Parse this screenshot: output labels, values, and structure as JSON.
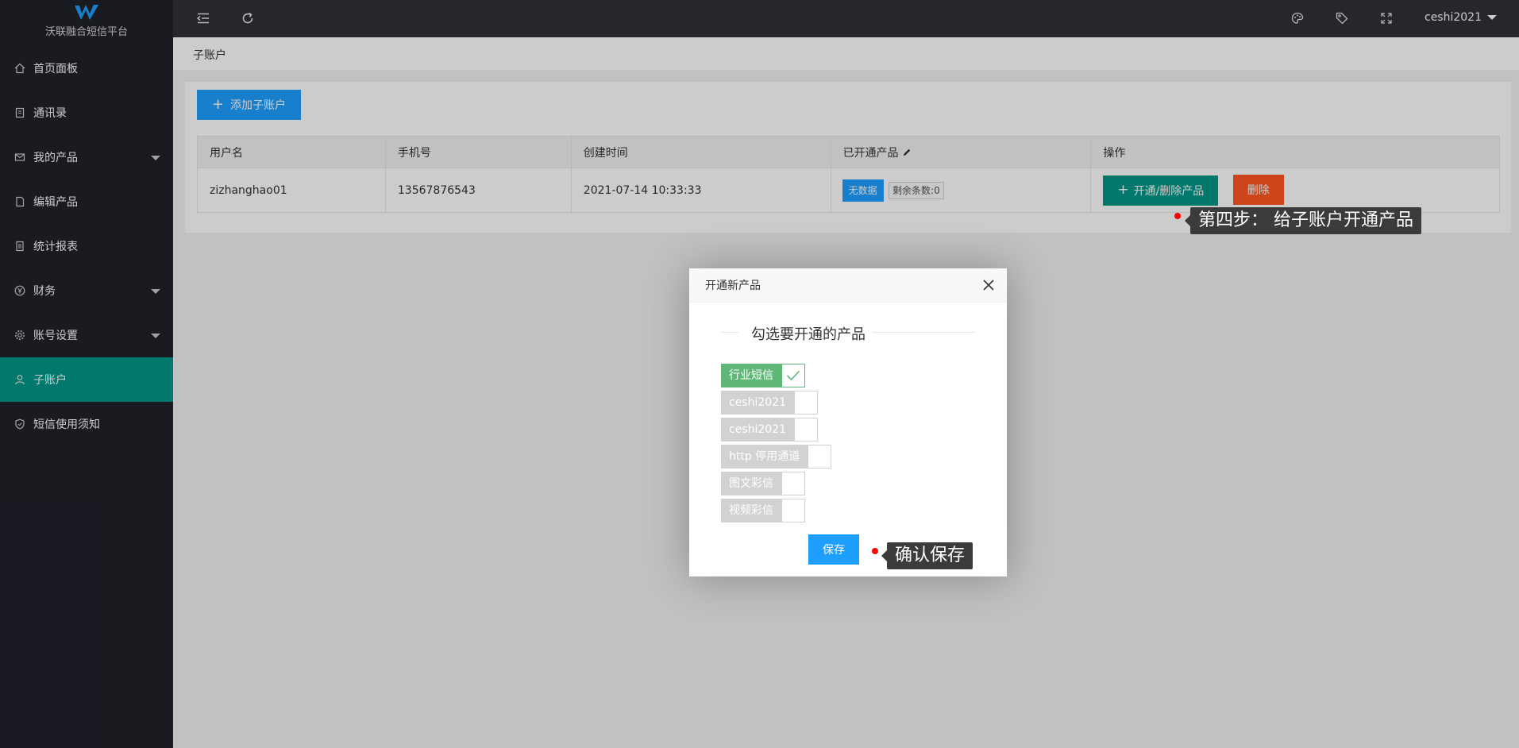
{
  "app": {
    "title": "沃联融合短信平台",
    "user": "ceshi2021"
  },
  "sidebar": {
    "items": [
      {
        "label": "首页面板",
        "icon": "home-icon"
      },
      {
        "label": "通讯录",
        "icon": "address-book-icon"
      },
      {
        "label": "我的产品",
        "icon": "mail-icon"
      },
      {
        "label": "编辑产品",
        "icon": "edit-doc-icon"
      },
      {
        "label": "统计报表",
        "icon": "report-icon"
      },
      {
        "label": "财务",
        "icon": "yen-icon"
      },
      {
        "label": "账号设置",
        "icon": "gear-icon"
      },
      {
        "label": "子账户",
        "icon": "user-icon"
      },
      {
        "label": "短信使用须知",
        "icon": "shield-icon"
      }
    ]
  },
  "breadcrumb": {
    "current": "子账户"
  },
  "toolbar": {
    "add_label": "添加子账户"
  },
  "table": {
    "headers": [
      "用户名",
      "手机号",
      "创建时间",
      "已开通产品",
      "操作"
    ],
    "rows": [
      {
        "username": "zizhanghao01",
        "phone": "13567876543",
        "created": "2021-07-14 10:33:33",
        "product_tag": "无数据",
        "remain": "剩余条数:0",
        "open_label": "开通/删除产品",
        "delete_label": "删除"
      }
    ]
  },
  "annotations": {
    "step4": "第四步：  给子账户开通产品",
    "confirm": "确认保存"
  },
  "modal": {
    "title": "开通新产品",
    "legend": "勾选要开通的产品",
    "options": [
      {
        "label": "行业短信",
        "checked": true
      },
      {
        "label": "ceshi2021",
        "checked": false
      },
      {
        "label": "ceshi2021",
        "checked": false
      },
      {
        "label": "http 停用通道",
        "checked": false
      },
      {
        "label": "图文彩信",
        "checked": false
      },
      {
        "label": "视频彩信",
        "checked": false
      }
    ],
    "save_label": "保存"
  },
  "colors": {
    "sidebar_bg": "#20222a",
    "active": "#009688",
    "primary": "#1e9fff",
    "danger": "#ff5722",
    "checked": "#5fb878"
  }
}
